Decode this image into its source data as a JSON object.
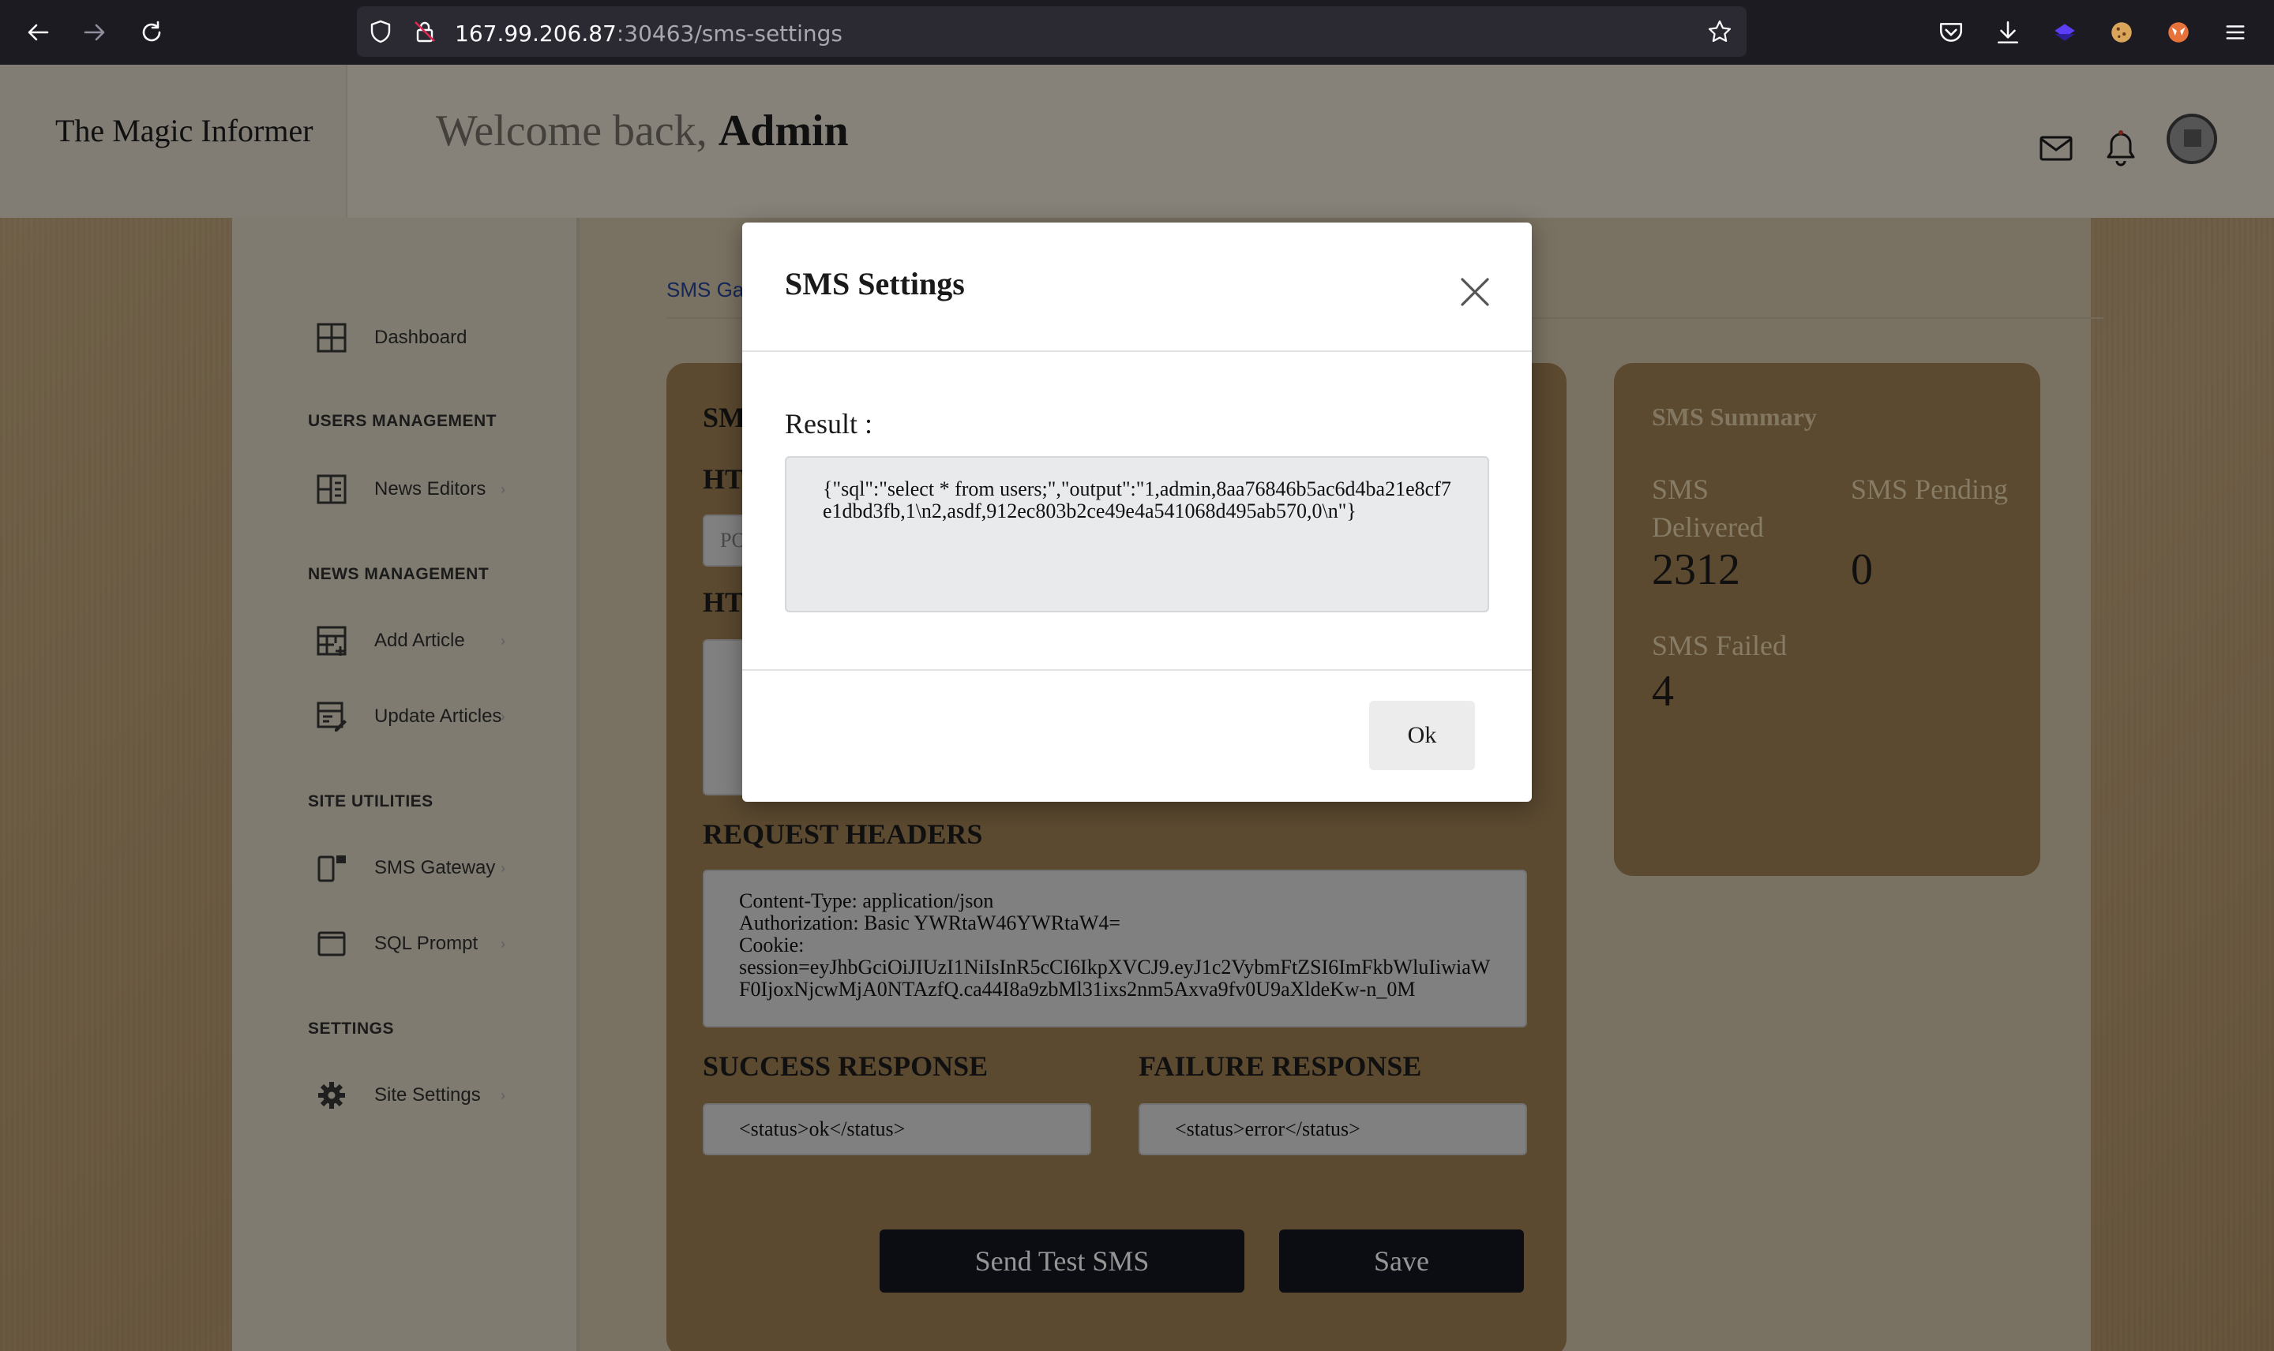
{
  "browser": {
    "url_host": "167.99.206.87",
    "url_path": ":30463/sms-settings"
  },
  "header": {
    "brand": "The Magic Informer",
    "welcome_prefix": "Welcome back,",
    "welcome_user": "Admin"
  },
  "sidebar": {
    "items": [
      {
        "label": "Dashboard",
        "icon": "dashboard-icon"
      },
      {
        "label": "News Editors",
        "icon": "editors-icon"
      },
      {
        "label": "Add Article",
        "icon": "add-article-icon"
      },
      {
        "label": "Update Articles",
        "icon": "update-articles-icon"
      },
      {
        "label": "SMS Gateway",
        "icon": "sms-gateway-icon"
      },
      {
        "label": "SQL Prompt",
        "icon": "sql-prompt-icon"
      },
      {
        "label": "Site Settings",
        "icon": "gear-icon"
      }
    ],
    "sections": [
      "USERS MANAGEMENT",
      "NEWS MANAGEMENT",
      "SITE UTILITIES",
      "SETTINGS"
    ]
  },
  "main": {
    "breadcrumb": "SMS Ga",
    "left_card": {
      "heading_sm": "SM",
      "heading_ht1": "HT",
      "heading_ht2": "HT",
      "input_partial": "PO",
      "request_headers_title": "REQUEST HEADERS",
      "request_headers_value": "Content-Type: application/json\nAuthorization: Basic YWRtaW46YWRtaW4=\nCookie:\nsession=eyJhbGciOiJIUzI1NiIsInR5cCI6IkpXVCJ9.eyJ1c2VybmFtZSI6ImFkbWluIiwiaWF0IjoxNjcwMjA0NTAzfQ.ca44I8a9zbMl31ixs2nm5Axva9fv0U9aXldeKw-n_0M",
      "success_title": "SUCCESS RESPONSE",
      "success_value": "<status>ok</status>",
      "failure_title": "FAILURE RESPONSE",
      "failure_value": "<status>error</status>",
      "send_test_label": "Send Test SMS",
      "save_label": "Save"
    },
    "summary": {
      "title": "SMS Summary",
      "delivered_label": "SMS Delivered",
      "delivered_value": "2312",
      "pending_label": "SMS Pending",
      "pending_value": "0",
      "failed_label": "SMS Failed",
      "failed_value": "4"
    }
  },
  "modal": {
    "title": "SMS Settings",
    "result_label": "Result :",
    "result_text": "{\"sql\":\"select * from users;\",\"output\":\"1,admin,8aa76846b5ac6d4ba21e8cf7e1dbd3fb,1\\n2,asdf,912ec803b2ce49e4a541068d495ab570,0\\n\"}",
    "ok_label": "Ok"
  }
}
